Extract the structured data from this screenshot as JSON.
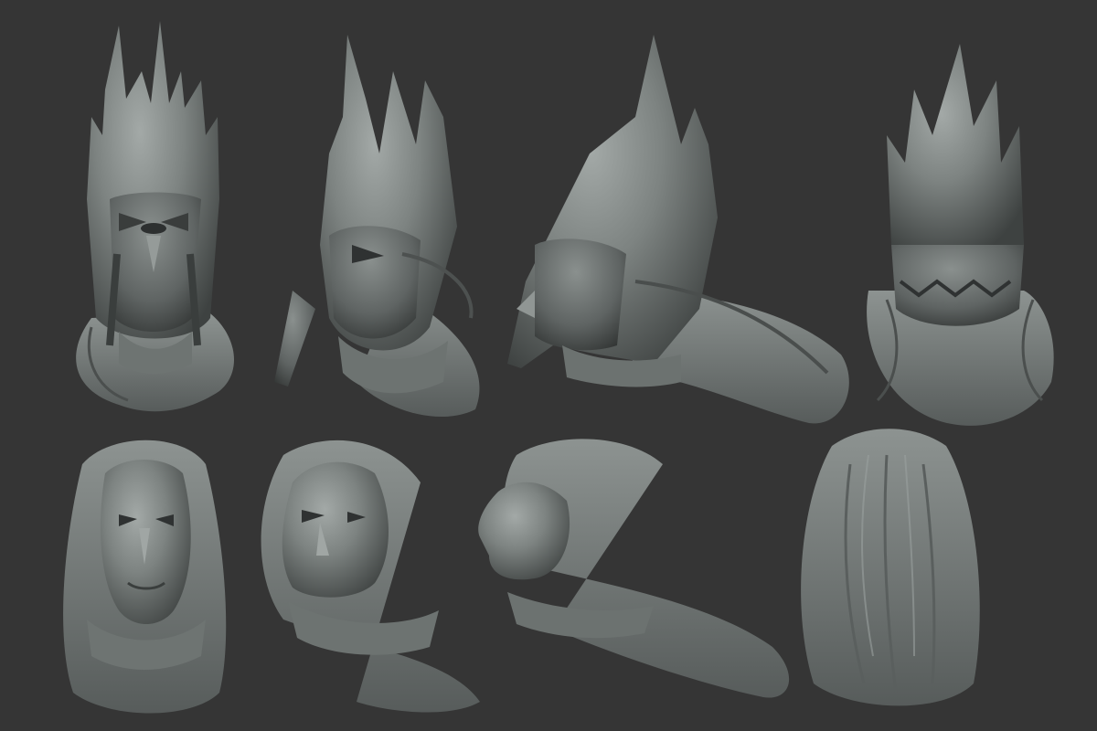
{
  "scene": {
    "description_none": "",
    "palette": {
      "background": "#353535",
      "clay_light": "#9aa09e",
      "clay_mid": "#7c8280",
      "clay_dark": "#4a4e4d",
      "clay_shadow": "#2b2d2d"
    },
    "rows": [
      {
        "id": "helmeted",
        "views": [
          {
            "id": "front",
            "angle": "front"
          },
          {
            "id": "three-quarter",
            "angle": "three-quarter"
          },
          {
            "id": "profile",
            "angle": "profile"
          },
          {
            "id": "back",
            "angle": "back"
          }
        ]
      },
      {
        "id": "unhelmeted",
        "views": [
          {
            "id": "front",
            "angle": "front"
          },
          {
            "id": "three-quarter",
            "angle": "three-quarter"
          },
          {
            "id": "profile",
            "angle": "profile"
          },
          {
            "id": "back",
            "angle": "back"
          }
        ]
      }
    ]
  }
}
